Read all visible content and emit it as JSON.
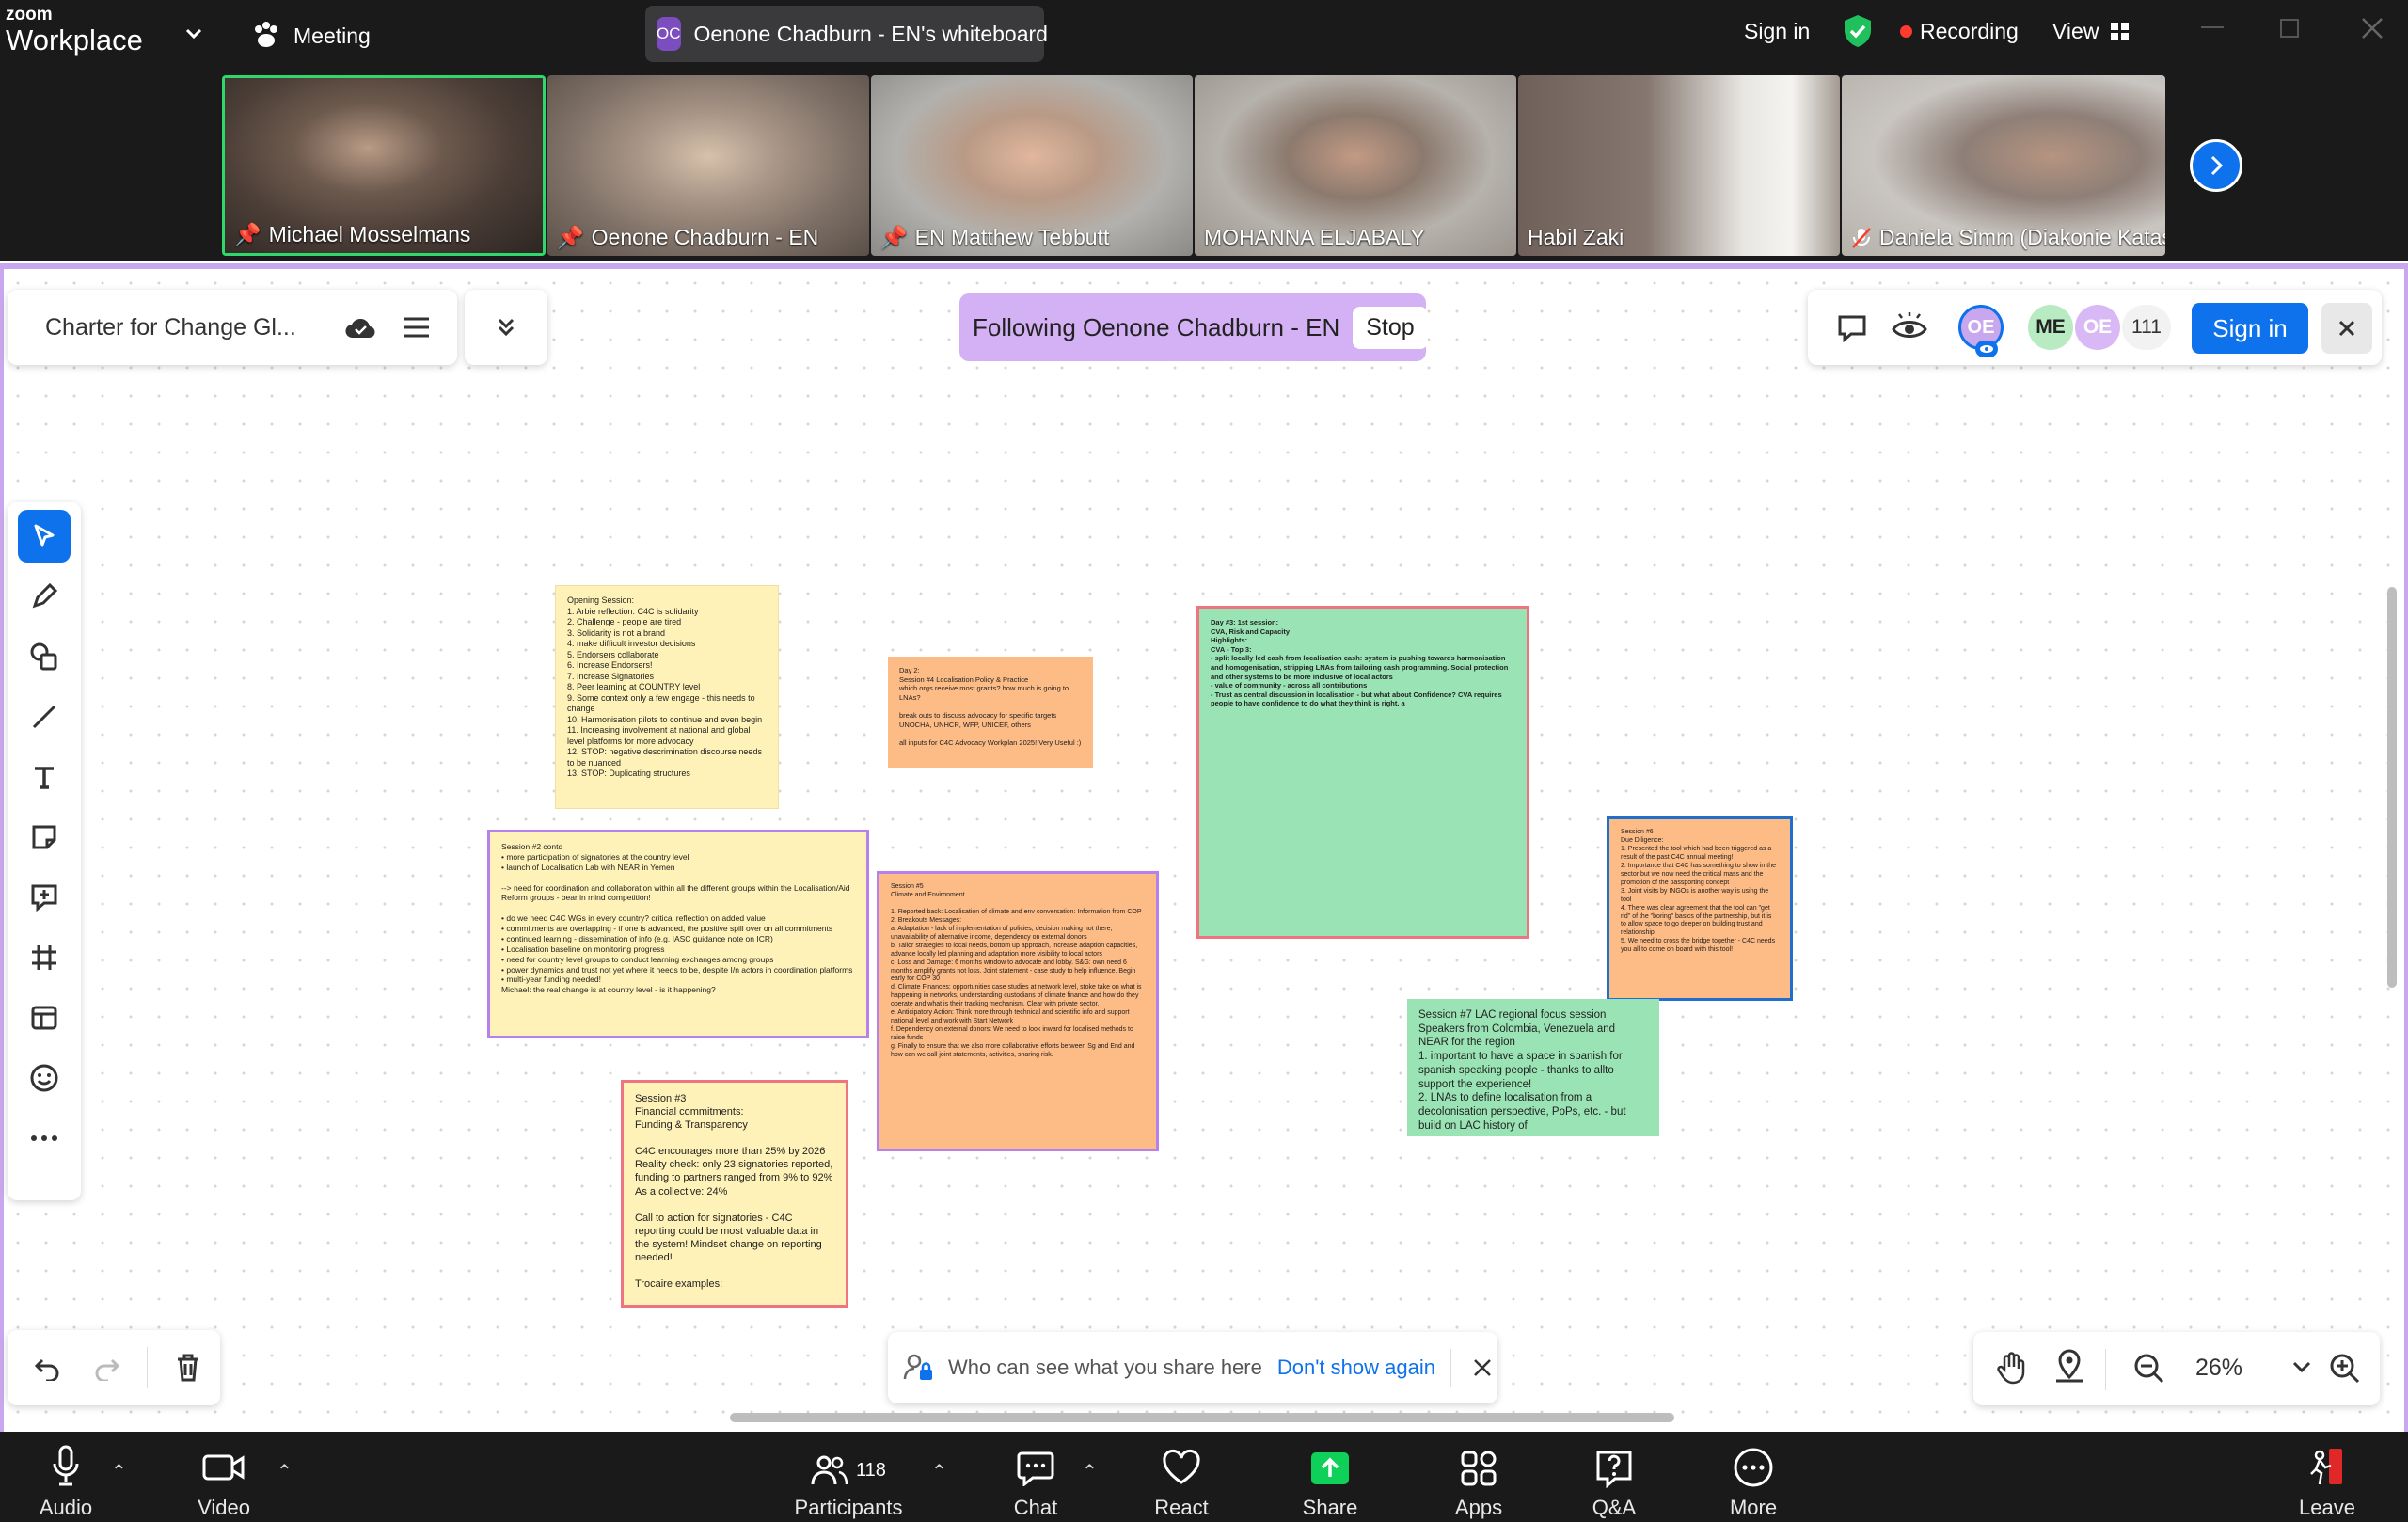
{
  "app": {
    "brand_top": "zoom",
    "brand_bottom": "Workplace",
    "meeting_label": "Meeting",
    "share_tab_initials": "OC",
    "share_tab_title": "Oenone Chadburn - EN's whiteboard",
    "sign_in": "Sign in",
    "recording": "Recording",
    "view": "View"
  },
  "participants_strip": [
    {
      "name": "Michael Mosselmans",
      "pinned": true,
      "muted": false
    },
    {
      "name": "Oenone Chadburn - EN",
      "pinned": true,
      "muted": false
    },
    {
      "name": "EN Matthew Tebbutt",
      "pinned": true,
      "muted": false
    },
    {
      "name": "MOHANNA ELJABALY",
      "pinned": false,
      "muted": false
    },
    {
      "name": "Habil Zaki",
      "pinned": false,
      "muted": false
    },
    {
      "name": "Daniela Simm (Diakonie Katas...",
      "pinned": false,
      "muted": true
    }
  ],
  "whiteboard": {
    "title": "Charter for Change Gl...",
    "following_text": "Following Oenone Chadburn - EN",
    "stop_label": "Stop",
    "avatar_oe": "OE",
    "avatar_me": "ME",
    "avatar_oe2": "OE",
    "viewer_count": "111",
    "sign_in_button": "Sign in",
    "share_hint": "Who can see what you share here",
    "dont_show_again": "Don't show again",
    "zoom_level": "26%"
  },
  "notes": {
    "opening": "Opening Session:\n 1. Arbie reflection: C4C is solidarity\n 2. Challenge - people are tired\n 3. Solidarity is not a brand\n 4. make difficult investor decisions\n 5. Endorsers collaborate\n 6. Increase Endorsers!\n 7. Increase Signatories\n 8. Peer learning at COUNTRY level\n 9. Some context only a few engage - this needs to change\n 10. Harmonisation pilots to continue and even begin\n 11. Increasing involvement at national and global level platforms for more advocacy\n 12. STOP: negative descrimination discourse needs to be nuanced\n 13. STOP: Duplicating structures",
    "day2": "Day 2:\nSession #4 Localisation Policy & Practice\nwhich orgs receive most grants? how much is going to LNAs?\n\nbreak outs to discuss advocacy for specific targets UNOCHA, UNHCR, WFP, UNICEF, others\n\nall inputs for C4C Advocacy Workplan 2025! Very Useful :)",
    "day3": "Day #3: 1st session:\nCVA, Risk and Capacity\nHighlights:\nCVA - Top 3:\n  - split locally led cash from localisation cash: system is pushing towards harmonisation and homogenisation, stripping LNAs from tailoring cash programming. Social protection and other systems to be more inclusive of local actors\n  - value of community - across all contributions\n  - Trust as central discussion in localisation - but what about Confidence? CVA requires people to have confidence to do what they think is right. a",
    "session2": "Session #2 contd\n  • more participation of signatories at the country level\n  • launch of Localisation Lab with NEAR in Yemen\n\n--> need for coordination and collaboration within all the different groups within the Localisation/Aid Reform groups - bear in mind competition!\n\n  • do we need C4C WGs in every country? critical reflection on added value\n  • commitments are overlapping - if one is advanced, the positive spill over on all commitments\n  • continued learning - dissemination of info (e.g. IASC guidance note on ICR)\n  • Localisation baseline on monitoring progress\n  • need for country level groups to conduct learning exchanges among groups\n  • power dynamics and trust not yet where it needs to be, despite I/n actors in coordination platforms\n  • multi-year funding needed!\nMichael: the real change is at country level - is it happening?",
    "session5": "Session #5\nClimate and Environment\n\n 1. Reported back: Localisation of climate and env conversation: Information from COP\n 2. Breakouts Messages:\n   a. Adaptation - lack of implementation of policies, decision making not there, unavailability of alternative income, dependency on external donors\n   b. Tailor strategies to local needs, bottom up approach, increase adaption capacities, advance locally led planning and adaptation more visibility to local actors\n   c. Loss and Damage: 6 months window to advocate and lobby. S&G: own need 6 months amplify grants not loss. Joint statement - case study to help influence. Begin early for COP 30\n   d. Climate Finances: opportunities case studies at network level, stoke take on what is happening in networks, understanding custodians of climate finance and how do they operate and what is their tracking mechanism. Clear with private sector.\n   e. Anticipatory Action: Think more through technical and scientific info and support national level and work with Start Network\n   f. Dependency on external donors: We need to look inward for localised methods to raise funds\n   g. Finally to ensure that we also more collaborative efforts between Sg and End and how can we call joint statements, activities, sharing risk.",
    "session6": "Session #6\nDue Diligence:\n 1. Presented the tool which had been triggered as a result of the past C4C annual meeting!\n 2. Importance that C4C has something to show in the sector but we now need the critical mass and the promotion of the passporting concept\n 3. Joint visits by INGOs is another way is using the tool\n 4. There was clear agreement that the tool can \"get rid\" of the \"boring\" basics of the partnership, but it is to allow space to go deeper on building trust and relationship\n 5. We need to cross the bridge together - C4C needs you all to come on board with this tool!",
    "session7": "Session #7 LAC regional focus session\nSpeakers from Colombia, Venezuela and NEAR for the region\n  1. important to have a space in spanish for spanish speaking people - thanks to allto support the experience!\n  2. LNAs to define localisation from a decolonisation perspective, PoPs, etc. - but build on LAC history of",
    "session3": "Session #3\nFinancial commitments:\nFunding & Transparency\n\nC4C encourages more than 25% by 2026\nReality check: only 23 signatories reported, funding to partners ranged from 9% to 92%\nAs a collective: 24%\n\nCall to action for signatories - C4C reporting could be most valuable data in the system! Mindset change on reporting needed!\n\nTrocaire examples:"
  },
  "controls": {
    "audio": "Audio",
    "video": "Video",
    "participants": "Participants",
    "participants_count": "118",
    "chat": "Chat",
    "react": "React",
    "share": "Share",
    "apps": "Apps",
    "qa": "Q&A",
    "more": "More",
    "leave": "Leave"
  },
  "colors": {
    "accent_blue": "#0e72ed",
    "board_border": "#c9a7ee",
    "share_green": "#0fd058",
    "recording_red": "#ff3b30",
    "note_yellow": "#fff2b8",
    "note_orange": "#fdbb86",
    "note_green": "#9ae3b5"
  }
}
